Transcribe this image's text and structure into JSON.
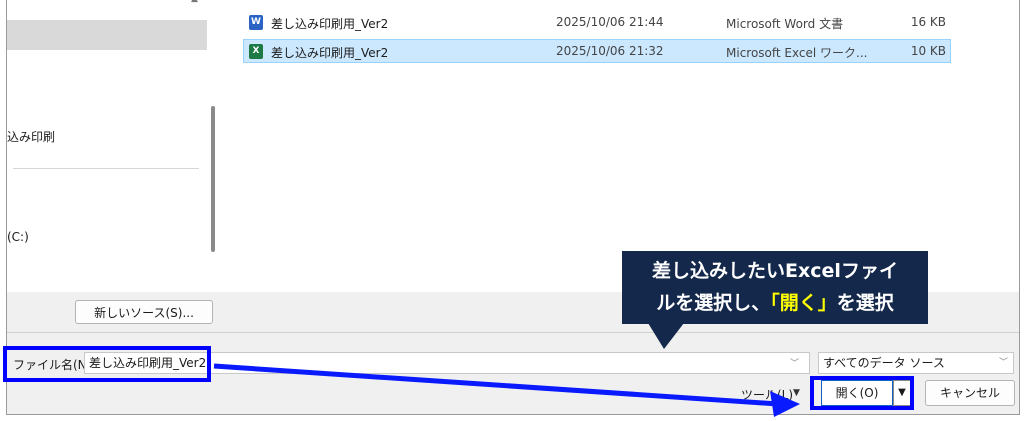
{
  "nav": {
    "item_label": "込み印刷",
    "drive_label": "(C:)"
  },
  "files": [
    {
      "icon": "word-doc-icon",
      "icon_letter": "W",
      "name": "差し込み印刷用_Ver2",
      "date": "2025/10/06 21:44",
      "type": "Microsoft Word 文書",
      "size": "16 KB",
      "selected": false
    },
    {
      "icon": "excel-sheet-icon",
      "icon_letter": "X",
      "name": "差し込み印刷用_Ver2",
      "date": "2025/10/06 21:32",
      "type": "Microsoft Excel ワーク...",
      "size": "10 KB",
      "selected": true
    }
  ],
  "new_source_label": "新しいソース(S)...",
  "filename": {
    "label": "ファイル名(N):",
    "value": "差し込み印刷用_Ver2"
  },
  "filetype": {
    "value": "すべてのデータ ソース"
  },
  "tools_label": "ツール(L)",
  "open_label": "開く(O)",
  "cancel_label": "キャンセル",
  "callout": {
    "line1": "差し込みしたいExcelファイ",
    "line2_prefix": "ルを選択し、",
    "line2_highlight": "「開く」",
    "line2_suffix": "を選択"
  },
  "colors": {
    "highlight_box": "#0000ff",
    "callout_bg": "#14284b",
    "callout_text": "#ffffff",
    "callout_highlight": "#ffff00",
    "selected_row": "#cce8ff"
  }
}
